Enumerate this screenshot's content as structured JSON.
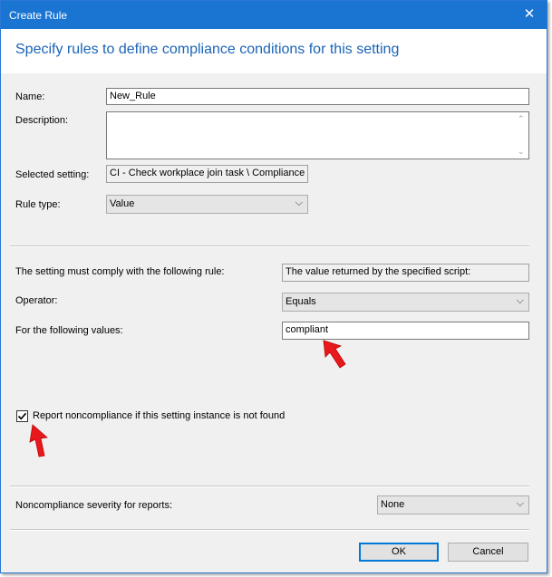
{
  "window": {
    "title": "Create Rule",
    "close_glyph": "✕"
  },
  "heading": "Specify rules to define compliance conditions for this setting",
  "form": {
    "name_label": "Name:",
    "name_value": "New_Rule",
    "description_label": "Description:",
    "description_value": "",
    "selected_setting_label": "Selected setting:",
    "selected_setting_value": "CI - Check workplace join task \\ Compliance",
    "rule_type_label": "Rule type:",
    "rule_type_value": "Value"
  },
  "rule": {
    "comply_label": "The setting must comply with the following rule:",
    "comply_value": "The value returned by the specified script:",
    "operator_label": "Operator:",
    "operator_value": "Equals",
    "values_label": "For the following values:",
    "values_value": "compliant"
  },
  "report": {
    "checkbox_label": "Report noncompliance if this setting instance is not found",
    "checked": true
  },
  "severity": {
    "label": "Noncompliance severity for reports:",
    "value": "None"
  },
  "buttons": {
    "ok": "OK",
    "cancel": "Cancel"
  },
  "colors": {
    "titlebar": "#1974d2",
    "heading": "#1a64b8",
    "arrow": "#e8191c"
  }
}
